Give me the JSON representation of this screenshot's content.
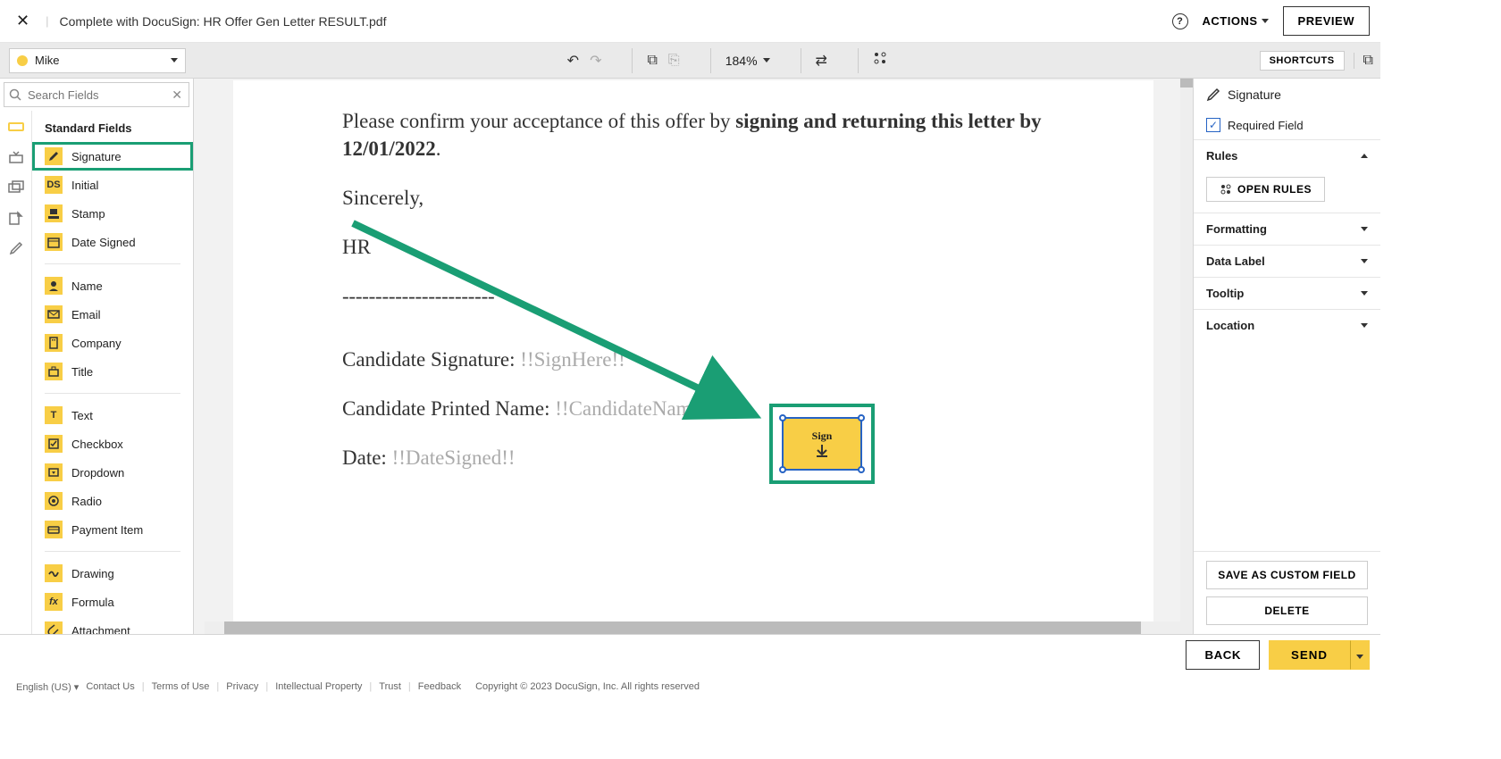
{
  "header": {
    "title": "Complete with DocuSign: HR Offer Gen Letter RESULT.pdf",
    "actions_label": "ACTIONS",
    "preview_label": "PREVIEW"
  },
  "toolbar": {
    "recipient_name": "Mike",
    "zoom": "184%",
    "shortcuts_label": "SHORTCUTS"
  },
  "search": {
    "placeholder": "Search Fields"
  },
  "fields": {
    "header": "Standard Fields",
    "signature": "Signature",
    "initial": "Initial",
    "stamp": "Stamp",
    "date_signed": "Date Signed",
    "name": "Name",
    "email": "Email",
    "company": "Company",
    "title": "Title",
    "text": "Text",
    "checkbox": "Checkbox",
    "dropdown": "Dropdown",
    "radio": "Radio",
    "payment_item": "Payment Item",
    "drawing": "Drawing",
    "formula": "Formula",
    "attachment": "Attachment"
  },
  "document": {
    "line1a": "Please confirm your acceptance of this offer by ",
    "line1b": "signing and returning this letter by 12/01/2022",
    "line1c": ".",
    "sincerely": "Sincerely,",
    "hr": "HR",
    "dashes": "- - - - - - - - - - - - - - - - - - - - - - -",
    "cand_sig_label": "Candidate Signature: ",
    "cand_sig_ph": "!!SignHere!!",
    "cand_name_label": "Candidate Printed Name: ",
    "cand_name_ph": "!!CandidateName!!",
    "date_label": "Date: ",
    "date_ph": "!!DateSigned!!",
    "sign_box_label": "Sign"
  },
  "properties": {
    "title": "Signature",
    "required_label": "Required Field",
    "rules_header": "Rules",
    "open_rules": "OPEN RULES",
    "formatting": "Formatting",
    "data_label": "Data Label",
    "tooltip": "Tooltip",
    "location": "Location",
    "save_custom": "SAVE AS CUSTOM FIELD",
    "delete": "DELETE"
  },
  "actions": {
    "back": "BACK",
    "send": "SEND"
  },
  "footer": {
    "lang": "English (US)",
    "contact": "Contact Us",
    "terms": "Terms of Use",
    "privacy": "Privacy",
    "ip": "Intellectual Property",
    "trust": "Trust",
    "feedback": "Feedback",
    "copyright": "Copyright © 2023 DocuSign, Inc. All rights reserved"
  }
}
